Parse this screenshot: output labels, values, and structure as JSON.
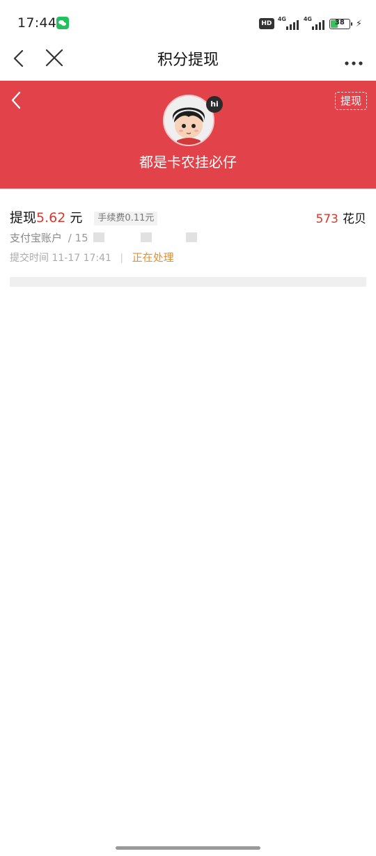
{
  "status_bar": {
    "time": "17:44",
    "hd": "HD",
    "network": "4G",
    "battery": "38",
    "battery_level": 0.38
  },
  "title_bar": {
    "title": "积分提现"
  },
  "banner": {
    "username": "都是卡农挂必仔",
    "avatar_badge": "hi",
    "withdraw_tag": "提现",
    "color": "#e2434a"
  },
  "record": {
    "label": "提现",
    "amount": "5.62",
    "unit": "元",
    "fee": "手续费0.11元",
    "points_value": "573",
    "points_unit": "花贝",
    "account_label": "支付宝账户",
    "account_value": "/ 15",
    "submit_label": "提交时间",
    "submit_time": "11-17 17:41",
    "status": "正在处理"
  },
  "colors": {
    "accent_red": "#d8382e",
    "status_orange": "#f08c1f"
  }
}
